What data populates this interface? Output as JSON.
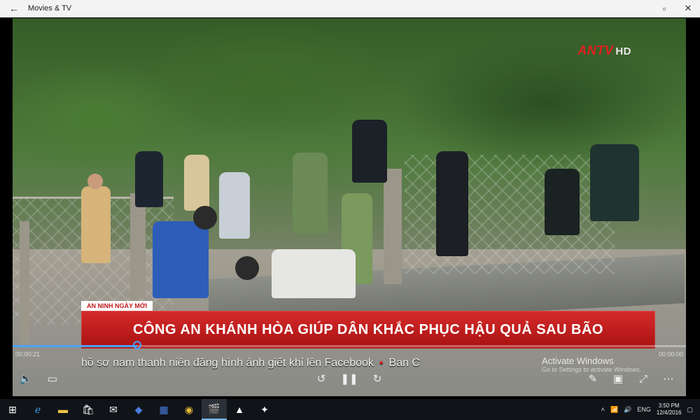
{
  "window": {
    "title": "Movies & TV",
    "back_icon": "←",
    "restore_icon": "▫",
    "close_icon": "✕"
  },
  "video": {
    "channel_logo_text": "ANTV",
    "channel_logo_hd": "HD",
    "section_tag": "AN NINH NGÀY MỚI",
    "headline": "CÔNG AN KHÁNH HÒA GIÚP DÂN KHẮC PHỤC HẬU QUẢ SAU BÃO",
    "ticker_text": "hồ sơ nam thanh niên đăng hình ảnh giết khỉ lên Facebook",
    "ticker_text2": "Ban C",
    "watermark_title": "Activate Windows",
    "watermark_sub": "Go to Settings to activate Windows."
  },
  "player": {
    "progress_fraction": 0.185,
    "time_elapsed": "00:00:21",
    "time_remaining": "00:00:00"
  },
  "taskbar": {
    "language": "ENG",
    "time": "3:50 PM",
    "date": "12/4/2016"
  },
  "colors": {
    "accent": "#4aa3ff",
    "headline_red": "#c21a1a"
  }
}
